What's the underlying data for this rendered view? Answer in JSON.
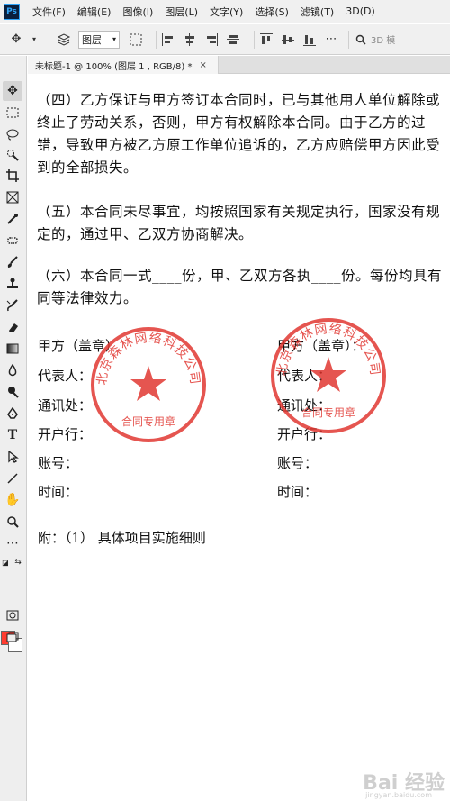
{
  "app": {
    "logo": "Ps"
  },
  "menu": [
    "文件(F)",
    "编辑(E)",
    "图像(I)",
    "图层(L)",
    "文字(Y)",
    "选择(S)",
    "滤镜(T)",
    "3D(D)"
  ],
  "options": {
    "layer_select": "图层",
    "search_hint": "3D 模"
  },
  "tab": {
    "title": "未标题-1 @ 100% (图层 1 , RGB/8) *",
    "close": "×"
  },
  "document": {
    "paragraphs": [
      "（四）乙方保证与甲方签订本合同时，已与其他用人单位解除或终止了劳动关系，否则，甲方有权解除本合同。由于乙方的过错，导致甲方被乙方原工作单位追诉的，乙方应赔偿甲方因此受到的全部损失。",
      "（五）本合同未尽事宜，均按照国家有关规定执行，国家没有规定的，通过甲、乙双方协商解决。",
      "（六）本合同一式____份，甲、乙双方各执____份。每份均具有同等法律效力。"
    ],
    "party_a": {
      "title": "甲方（盖章）",
      "rep": "代表人：",
      "address": "通讯处：",
      "bank": "开户行：",
      "account": "账号：",
      "date": "时间："
    },
    "party_b": {
      "title": "甲方（盖章）：",
      "rep": "代表人：",
      "address": "通讯处：",
      "bank": "开户行：",
      "account": "账号：",
      "date": "时间："
    },
    "appendix": "附：（1）  具体项目实施细则"
  },
  "seal": {
    "company": "北京森林网络科技公司",
    "purpose": "合同专用章",
    "color": "#e0302a"
  },
  "colors": {
    "foreground": "#ff3b2f",
    "background": "#ffffff"
  },
  "watermark": {
    "text": "Bai 经验",
    "sub": "jingyan.baidu.com"
  }
}
